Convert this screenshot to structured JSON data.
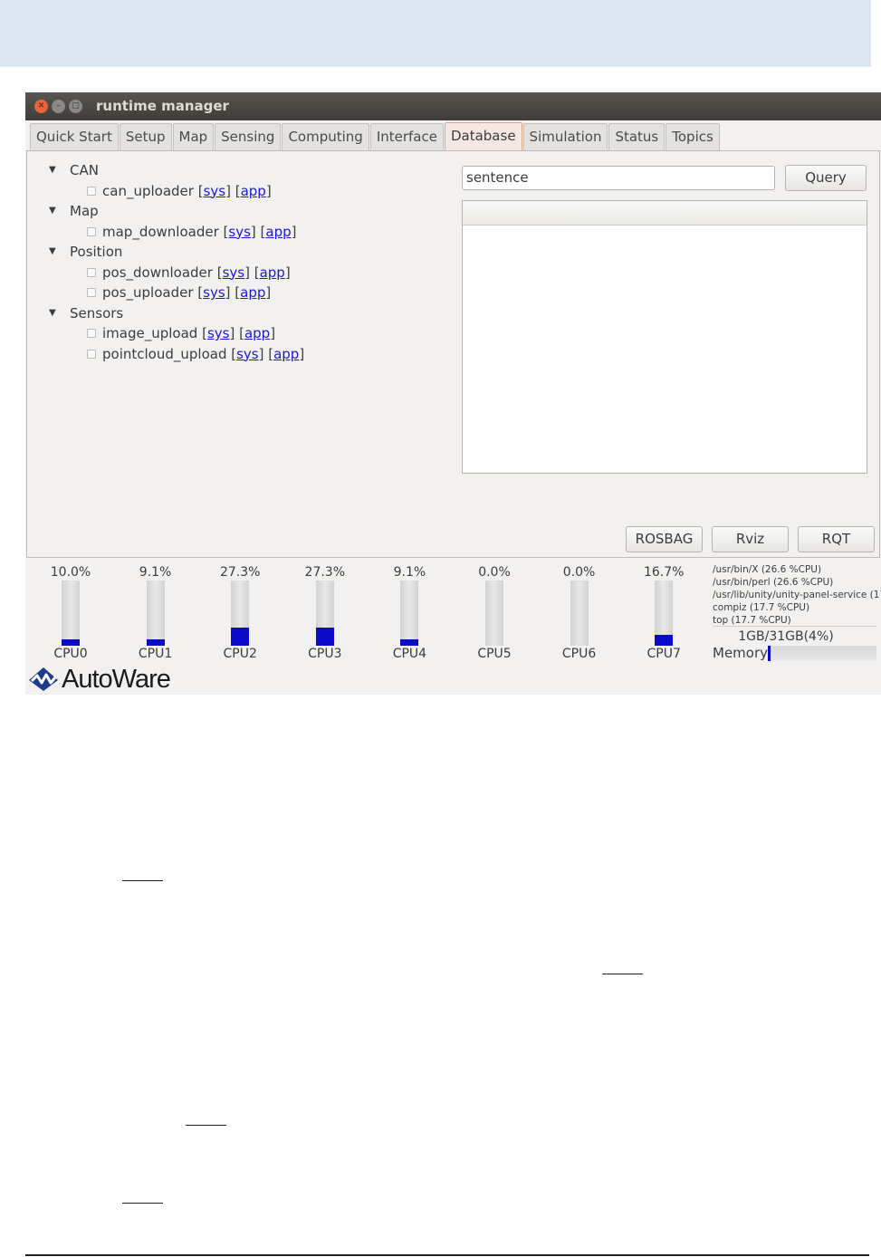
{
  "window": {
    "title": "runtime manager"
  },
  "tabs": [
    {
      "label": "Quick Start"
    },
    {
      "label": "Setup"
    },
    {
      "label": "Map"
    },
    {
      "label": "Sensing"
    },
    {
      "label": "Computing"
    },
    {
      "label": "Interface"
    },
    {
      "label": "Database",
      "active": true
    },
    {
      "label": "Simulation"
    },
    {
      "label": "Status"
    },
    {
      "label": "Topics"
    }
  ],
  "tree": {
    "groups": [
      {
        "label": "CAN",
        "items": [
          {
            "name": "can_uploader",
            "sys": "sys",
            "app": "app"
          }
        ]
      },
      {
        "label": "Map",
        "items": [
          {
            "name": "map_downloader",
            "sys": "sys",
            "app": "app"
          }
        ]
      },
      {
        "label": "Position",
        "items": [
          {
            "name": "pos_downloader",
            "sys": "sys",
            "app": "app"
          },
          {
            "name": "pos_uploader",
            "sys": "sys",
            "app": "app"
          }
        ]
      },
      {
        "label": "Sensors",
        "items": [
          {
            "name": "image_upload",
            "sys": "sys",
            "app": "app"
          },
          {
            "name": "pointcloud_upload",
            "sys": "sys",
            "app": "app"
          }
        ]
      }
    ]
  },
  "query": {
    "input_value": "sentence",
    "button_label": "Query"
  },
  "buttons": {
    "rosbag": "ROSBAG",
    "rviz": "Rviz",
    "rqt": "RQT"
  },
  "cpus": [
    {
      "label": "CPU0",
      "percent_text": "10.0%",
      "percent": 10.0
    },
    {
      "label": "CPU1",
      "percent_text": "9.1%",
      "percent": 9.1
    },
    {
      "label": "CPU2",
      "percent_text": "27.3%",
      "percent": 27.3
    },
    {
      "label": "CPU3",
      "percent_text": "27.3%",
      "percent": 27.3
    },
    {
      "label": "CPU4",
      "percent_text": "9.1%",
      "percent": 9.1
    },
    {
      "label": "CPU5",
      "percent_text": "0.0%",
      "percent": 0.0
    },
    {
      "label": "CPU6",
      "percent_text": "0.0%",
      "percent": 0.0
    },
    {
      "label": "CPU7",
      "percent_text": "16.7%",
      "percent": 16.7
    }
  ],
  "processes": [
    "/usr/bin/X (26.6 %CPU)",
    "/usr/bin/perl (26.6 %CPU)",
    "/usr/lib/unity/unity-panel-service (17",
    "compiz (17.7 %CPU)",
    "top (17.7 %CPU)"
  ],
  "memory": {
    "value_text": "1GB/31GB(4%)",
    "label": "Memory",
    "percent": 4
  },
  "logo": {
    "text": "AutoWare"
  },
  "colors": {
    "accent_bar": "#0a0ac8",
    "active_tab": "#f5e8e2",
    "link": "#1a1ad0",
    "top_band": "#dce6f2"
  }
}
